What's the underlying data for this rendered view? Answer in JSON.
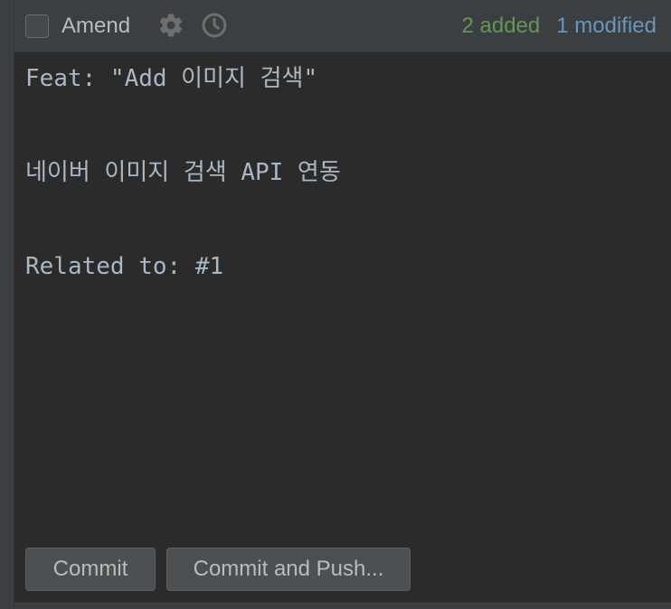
{
  "toolbar": {
    "amend_label": "Amend",
    "amend_checked": false,
    "icons": [
      "gear-icon",
      "clock-icon"
    ],
    "added_text": "2 added",
    "modified_text": "1 modified",
    "added_color": "#629755",
    "modified_color": "#6897bb"
  },
  "commit_message": {
    "lines": [
      "Feat: \"Add 이미지 검색\"",
      "네이버 이미지 검색 API 연동",
      "Related to: #1"
    ]
  },
  "buttons": {
    "commit_label": "Commit",
    "commit_and_push_label": "Commit and Push..."
  }
}
